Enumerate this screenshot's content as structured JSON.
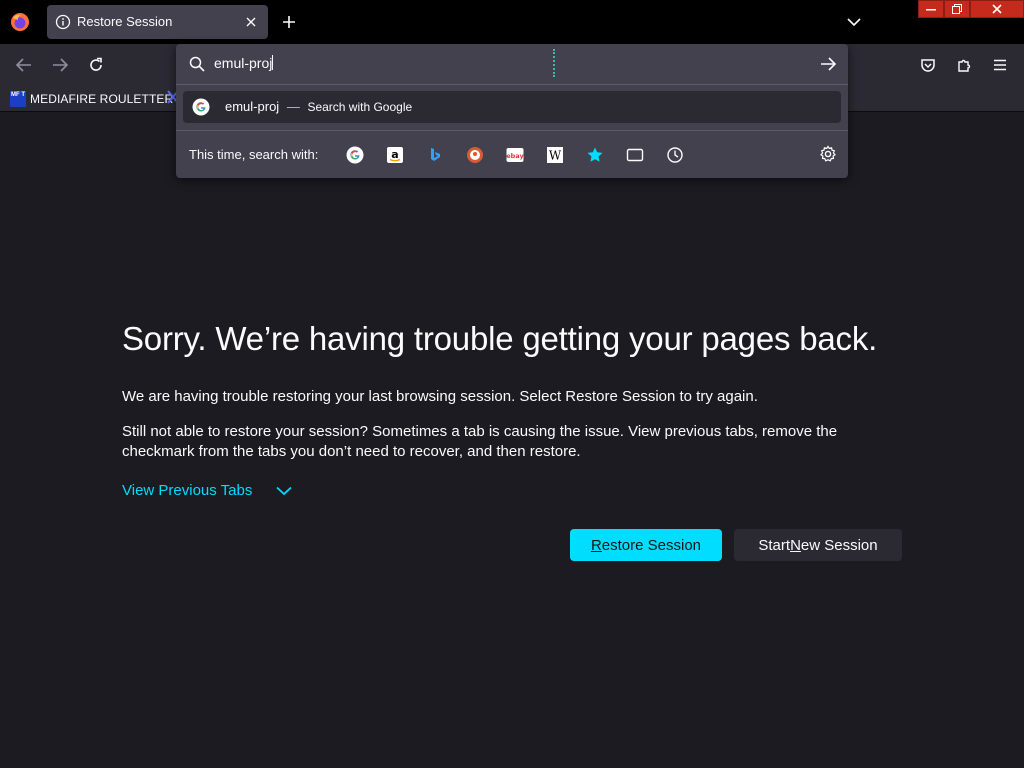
{
  "tabs": [
    {
      "title": "Restore Session",
      "icon": "info-icon"
    }
  ],
  "urlbar": {
    "value": "emul-proj",
    "suggestion": {
      "query": "emul-proj",
      "separator": "—",
      "action": "Search with Google"
    },
    "oneoff_label": "This time, search with:",
    "engines": [
      "google-icon",
      "amazon-icon",
      "bing-icon",
      "duckduckgo-icon",
      "ebay-icon",
      "wikipedia-icon",
      "bookmarks-star-icon",
      "tabs-icon",
      "history-icon"
    ]
  },
  "bookmarks": [
    {
      "label": "MEDIAFIRE ROULETTER",
      "favicon_text": "MF T"
    }
  ],
  "content": {
    "heading": "Sorry. We’re having trouble getting your pages back.",
    "para1": "We are having trouble restoring your last browsing session. Select Restore Session to try again.",
    "para2": "Still not able to restore your session? Sometimes a tab is causing the issue. View previous tabs, remove the checkmark from the tabs you don’t need to recover, and then restore.",
    "view_previous": "View Previous Tabs",
    "restore_button": {
      "prefix": "",
      "accel": "R",
      "rest": "estore Session"
    },
    "new_button": {
      "prefix": "Start ",
      "accel": "N",
      "rest": "ew Session"
    }
  },
  "colors": {
    "accent": "#00ddff",
    "background": "#1c1b22",
    "toolbar": "#2b2a33",
    "panel": "#42414d"
  }
}
